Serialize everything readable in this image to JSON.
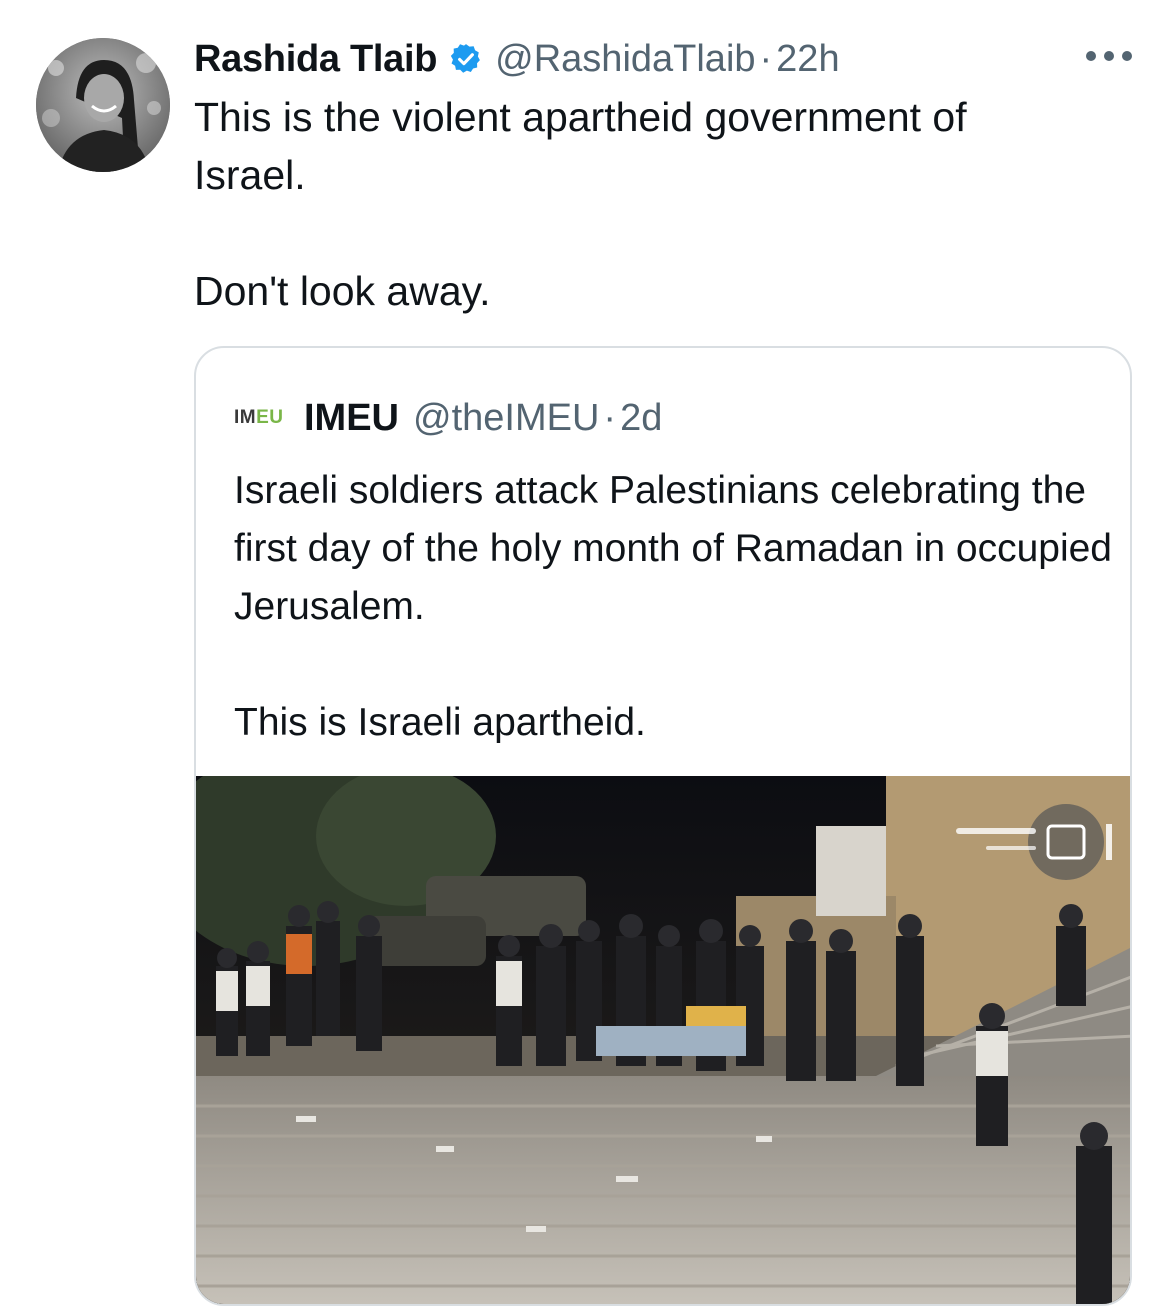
{
  "tweet": {
    "author": {
      "display_name": "Rashida Tlaib",
      "handle": "@RashidaTlaib",
      "verified": true
    },
    "separator": "·",
    "time": "22h",
    "more_icon": "more-horizontal-icon",
    "text_lines": [
      "This is the violent apartheid government of",
      "Israel."
    ],
    "text_line2": "Don't look away."
  },
  "quoted": {
    "logo": {
      "part1": "IM",
      "part2": "EU"
    },
    "display_name": "IMEU",
    "handle": "@theIMEU",
    "separator": "·",
    "time": "2d",
    "text_para1": "Israeli soldiers attack Palestinians celebrating the first day of the holy month of Ramadan in occupied Jerusalem.",
    "text_para2": "This is Israeli apartheid.",
    "media": {
      "type": "video",
      "watermark_logo": "al-qastal-logo"
    }
  },
  "colors": {
    "verified_blue": "#1d9bf0",
    "secondary_text": "#536471",
    "border": "#d9dee2",
    "imeu_green": "#7ab648"
  }
}
